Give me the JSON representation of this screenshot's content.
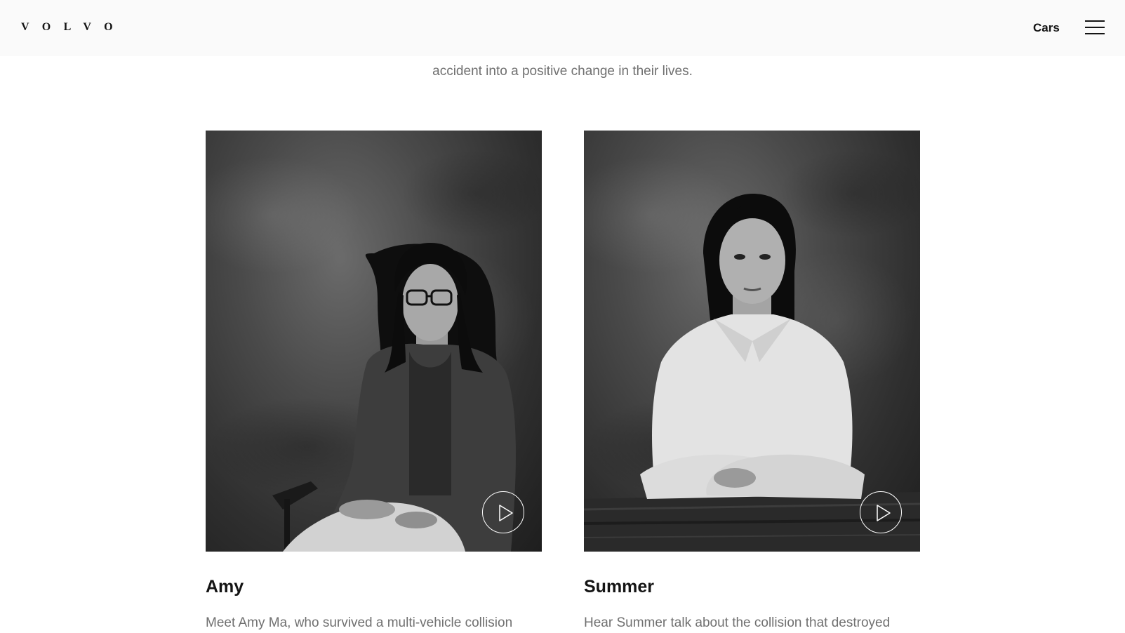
{
  "header": {
    "logo": "VOLVO",
    "nav_cars": "Cars",
    "menu_icon": "hamburger-menu-icon"
  },
  "intro": {
    "line1": "into a positive change in their lives.",
    "line2": "accident into a positive change in their lives."
  },
  "stories": [
    {
      "name": "Amy",
      "description": "Meet Amy Ma, who survived a multi-vehicle collision",
      "play_icon": "play-icon"
    },
    {
      "name": "Summer",
      "description": "Hear Summer talk about the collision that destroyed",
      "play_icon": "play-icon"
    }
  ],
  "colors": {
    "header_bg": "#fafafa",
    "text": "#141414",
    "muted_text": "#707070"
  }
}
